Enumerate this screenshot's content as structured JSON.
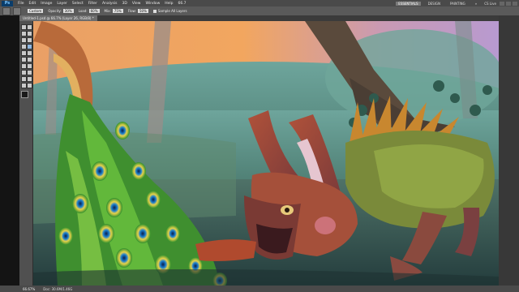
{
  "app": {
    "logo": "Ps"
  },
  "menu": {
    "items": [
      "File",
      "Edit",
      "Image",
      "Layer",
      "Select",
      "Filter",
      "Analysis",
      "3D",
      "View",
      "Window",
      "Help"
    ]
  },
  "menu_extras": {
    "zoom": "66.7"
  },
  "workspaces": {
    "essentials": "ESSENTIALS",
    "design": "DESIGN",
    "painting": "PAINTING",
    "more": "»"
  },
  "cs_live": "CS Live",
  "options": {
    "mode_label": "Mode:",
    "mode_value": "Custom",
    "opacity_label": "Opacity:",
    "opacity_value": "30%",
    "flow_label": "Flow:",
    "flow_value": "50%",
    "load_label": "Load:",
    "load_value": "60%",
    "mix_label": "Mix:",
    "mix_value": "75%",
    "sample_label": "Sample All Layers"
  },
  "doc_tab": "Untitled-1.psd @ 66.7% (Layer 26, RGB/8) *",
  "status": {
    "zoom": "66.67%",
    "doc": "Doc: 30.6M/1.46G"
  },
  "colors": {
    "foreground": "#1a1a1a",
    "background": "#ffffff",
    "accent": "#6a6a6a"
  }
}
